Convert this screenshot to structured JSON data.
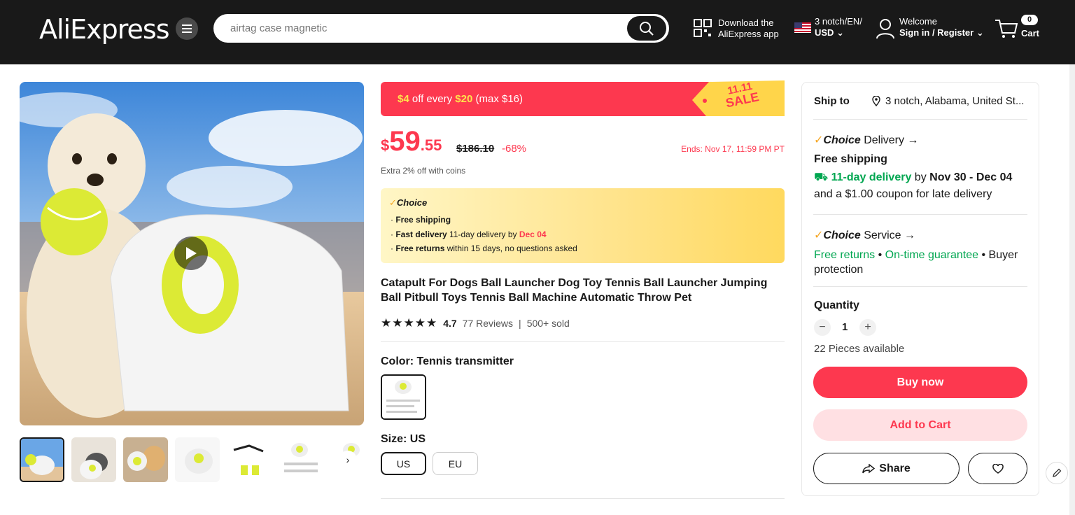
{
  "header": {
    "logo": "AliExpress",
    "search_placeholder": "airtag case magnetic",
    "download_line1": "Download the",
    "download_line2": "AliExpress app",
    "locale_line1": "3 notch/EN/",
    "locale_line2": "USD",
    "welcome": "Welcome",
    "signin": "Sign in / Register",
    "cart_count": "0",
    "cart_label": "Cart"
  },
  "promo": {
    "lead": "$4",
    "text1": " off every ",
    "mid": "$20",
    "text2": " (max $16)",
    "tag_line1": "11.11",
    "tag_line2": "SALE"
  },
  "price": {
    "currency": "$",
    "whole": "59",
    "cents": ".55",
    "original": "$186.10",
    "discount": "-68%",
    "ends": "Ends: Nov 17, 11:59 PM PT",
    "coins": "Extra 2% off with coins"
  },
  "choice_box": {
    "logo": "Choice",
    "line1_bold": "Free shipping",
    "line2_bold": "Fast delivery",
    "line2_text": " 11-day delivery by ",
    "line2_red": "Dec 04",
    "line3_bold": "Free returns",
    "line3_text": "  within 15 days, no questions asked"
  },
  "product": {
    "title": "Catapult For Dogs Ball Launcher Dog Toy Tennis Ball Launcher Jumping Ball Pitbull Toys Tennis Ball Machine Automatic Throw Pet",
    "rating": "4.7",
    "reviews": "77 Reviews",
    "sold": "500+ sold",
    "color_label": "Color: Tennis transmitter",
    "size_label": "Size: US",
    "sizes": [
      "US",
      "EU"
    ]
  },
  "side": {
    "ship_to_label": "Ship to",
    "ship_to_value": "3 notch, Alabama, United St...",
    "delivery_choice": "Choice",
    "delivery_label": " Delivery →",
    "free_shipping": "Free shipping",
    "delivery_days": "11-day delivery",
    "delivery_by": " by ",
    "delivery_dates": "Nov 30 - Dec 04",
    "coupon": "and a $1.00 coupon for late delivery",
    "service_choice": "Choice",
    "service_label": " Service →",
    "free_returns": "Free returns",
    "dot": " • ",
    "ontime": "On-time guarantee",
    "buyer_protection": " • Buyer protection",
    "quantity_label": "Quantity",
    "quantity_value": "1",
    "available": "22 Pieces available",
    "buy_now": "Buy now",
    "add_to_cart": "Add to Cart",
    "share": "Share"
  },
  "colors": {
    "accent": "#fd384f",
    "header_bg": "#191919",
    "green": "#00a650"
  }
}
